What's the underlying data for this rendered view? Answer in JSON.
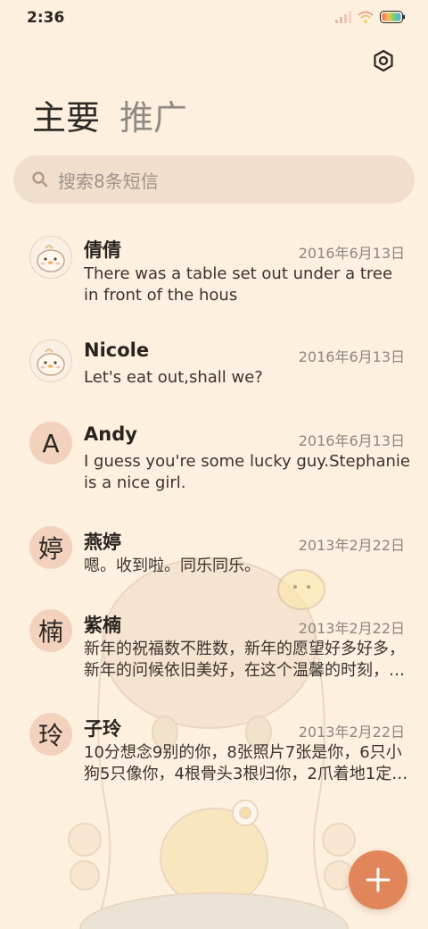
{
  "status_bar": {
    "time": "2:36",
    "icons": [
      "signal-icon",
      "wifi-icon",
      "battery-icon"
    ]
  },
  "header": {
    "settings_icon": "settings-hexagon-icon"
  },
  "tabs": [
    {
      "label": "主要",
      "active": true
    },
    {
      "label": "推广",
      "active": false
    }
  ],
  "search": {
    "placeholder": "搜索8条短信",
    "icon": "search-icon"
  },
  "messages": [
    {
      "avatar_type": "chick",
      "avatar_text": "",
      "name": "倩倩",
      "date": "2016年6月13日",
      "preview": "There was a table set out under a tree in front of the hous"
    },
    {
      "avatar_type": "chick",
      "avatar_text": "",
      "name": "Nicole",
      "date": "2016年6月13日",
      "preview": "Let's eat out,shall we?"
    },
    {
      "avatar_type": "letter",
      "avatar_text": "A",
      "name": "Andy",
      "date": "2016年6月13日",
      "preview": "I guess you're some lucky guy.Stephanie is a nice girl."
    },
    {
      "avatar_type": "letter",
      "avatar_text": "婷",
      "name": "燕婷",
      "date": "2013年2月22日",
      "preview": "嗯。收到啦。同乐同乐。"
    },
    {
      "avatar_type": "letter",
      "avatar_text": "楠",
      "name": "紫楠",
      "date": "2013年2月22日",
      "preview": "新年的祝福数不胜数，新年的愿望好多好多，新年的问候依旧美好，在这个温馨的时刻，…"
    },
    {
      "avatar_type": "letter",
      "avatar_text": "玲",
      "name": "子玲",
      "date": "2013年2月22日",
      "preview": "10分想念9别的你，8张照片7张是你，6只小狗5只像你，4根骨头3根归你，2爪着地1定是你…"
    }
  ],
  "fab": {
    "icon": "plus-icon"
  },
  "colors": {
    "background": "#fdf0df",
    "search_bg": "#f1dfcc",
    "avatar_bg": "#f3d2bd",
    "fab": "#e1865b"
  }
}
